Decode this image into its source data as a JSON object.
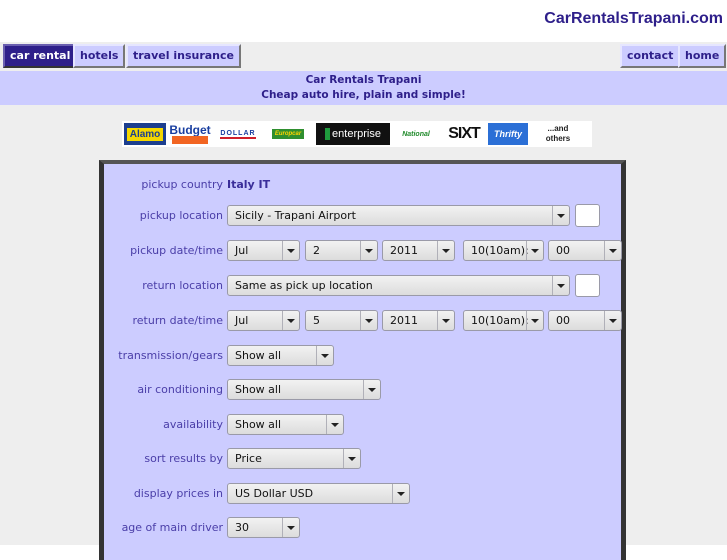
{
  "site": {
    "title": "CarRentalsTrapani.com"
  },
  "nav": {
    "left": [
      {
        "label": "car rental",
        "active": true
      },
      {
        "label": "hotels",
        "active": false
      },
      {
        "label": "travel insurance",
        "active": false
      }
    ],
    "right": [
      {
        "label": "contact"
      },
      {
        "label": "home"
      }
    ]
  },
  "banner": {
    "title": "Car Rentals Trapani",
    "subtitle": "Cheap auto hire, plain and simple!"
  },
  "logos": {
    "items": [
      "Alamo",
      "Budget",
      "DOLLAR",
      "Europcar",
      "enterprise",
      "National",
      "SIXT",
      "Thrifty"
    ],
    "more_line1": "...and",
    "more_line2": "others"
  },
  "form": {
    "pickup_country": {
      "label": "pickup country",
      "value": "Italy IT"
    },
    "pickup_location": {
      "label": "pickup location",
      "value": "Sicily - Trapani Airport"
    },
    "pickup_datetime": {
      "label": "pickup date/time",
      "month": "Jul",
      "day": "2",
      "year": "2011",
      "hour": "10(10am):",
      "minute": "00"
    },
    "return_location": {
      "label": "return location",
      "value": "Same as pick up location"
    },
    "return_datetime": {
      "label": "return date/time",
      "month": "Jul",
      "day": "5",
      "year": "2011",
      "hour": "10(10am):",
      "minute": "00"
    },
    "transmission": {
      "label": "transmission/gears",
      "value": "Show all"
    },
    "air_conditioning": {
      "label": "air conditioning",
      "value": "Show all"
    },
    "availability": {
      "label": "availability",
      "value": "Show all"
    },
    "sort_by": {
      "label": "sort results by",
      "value": "Price"
    },
    "currency": {
      "label": "display prices in",
      "value": "US Dollar USD"
    },
    "driver_age": {
      "label": "age of main driver",
      "value": "30"
    }
  }
}
